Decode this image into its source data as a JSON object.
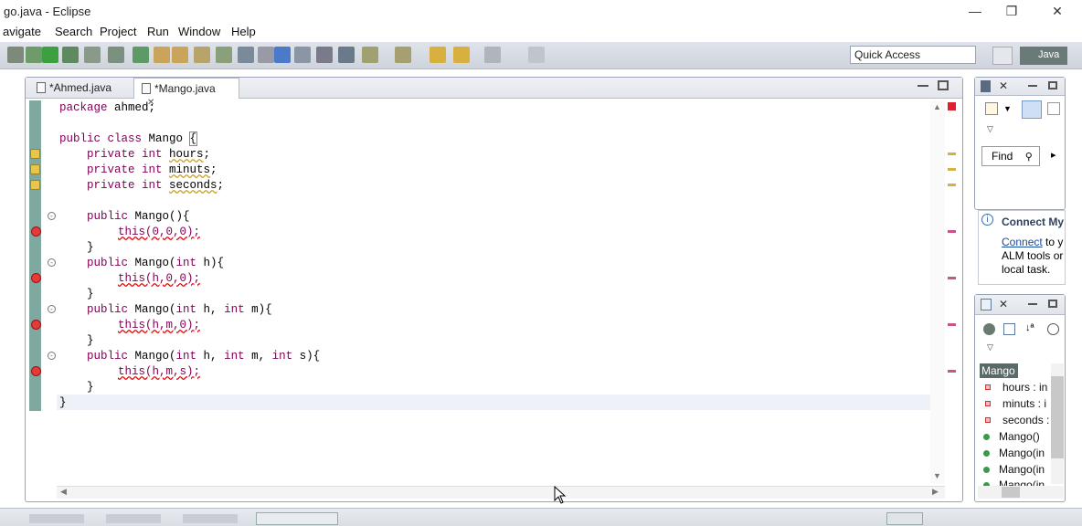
{
  "window": {
    "title": "go.java - Eclipse",
    "minimize": "—",
    "restore": "❐",
    "close": "✕"
  },
  "menu": [
    "avigate",
    "Search",
    "Project",
    "Run",
    "Window",
    "Help"
  ],
  "toolbar": {
    "quick_access": "Quick Access",
    "perspective_label": "Java"
  },
  "editor": {
    "tabs": [
      {
        "label": "*Ahmed.java"
      },
      {
        "label": "*Mango.java",
        "close": "✕"
      }
    ],
    "code": {
      "l1a": "package",
      "l1b": " ahmed;",
      "l3a": "public class",
      "l3b": " Mango ",
      "l3c": "{",
      "f1a": "    private int ",
      "f1b": "hours",
      "f1c": ";",
      "f2a": "    private int ",
      "f2b": "minuts",
      "f2c": ";",
      "f3a": "    private int ",
      "f3b": "seconds",
      "f3c": ";",
      "c1a": "    public",
      "c1b": " Mango(){",
      "c1t": "this(0,0,0);",
      "c2a": "    public",
      "c2b": " Mango(",
      "c2c": "int",
      "c2d": " h){",
      "c2t": "this(h,0,0);",
      "c3a": "    public",
      "c3b": " Mango(",
      "c3c": "int",
      "c3d": " h, ",
      "c3e": "int",
      "c3f": " m){",
      "c3t": "this(h,m,0);",
      "c4a": "    public",
      "c4b": " Mango(",
      "c4c": "int",
      "c4d": " h, ",
      "c4e": "int",
      "c4f": " m, ",
      "c4g": "int",
      "c4h": " s){",
      "c4t": "this(h,m,s);",
      "brace_in": "    }",
      "brace_out": "}"
    }
  },
  "task_panel": {
    "find_label": "Find",
    "find_icon": "search-icon",
    "arrow": "▸"
  },
  "connect_panel": {
    "title": "Connect My",
    "link": "Connect",
    "text1": " to y",
    "text2": "ALM tools or",
    "text3": "local task."
  },
  "outline": {
    "root": "Mango",
    "items": [
      {
        "label": "hours : in",
        "kind": "field"
      },
      {
        "label": "minuts : i",
        "kind": "field"
      },
      {
        "label": "seconds :",
        "kind": "field"
      },
      {
        "label": "Mango()",
        "kind": "ctor"
      },
      {
        "label": "Mango(in",
        "kind": "ctor"
      },
      {
        "label": "Mango(in",
        "kind": "ctor"
      },
      {
        "label": "Mango(in",
        "kind": "ctor"
      }
    ]
  },
  "colors": {
    "keyword": "#7f0055",
    "error": "#e63a3a",
    "warning": "#e8c64a",
    "gutter": "#7fa8a0"
  }
}
